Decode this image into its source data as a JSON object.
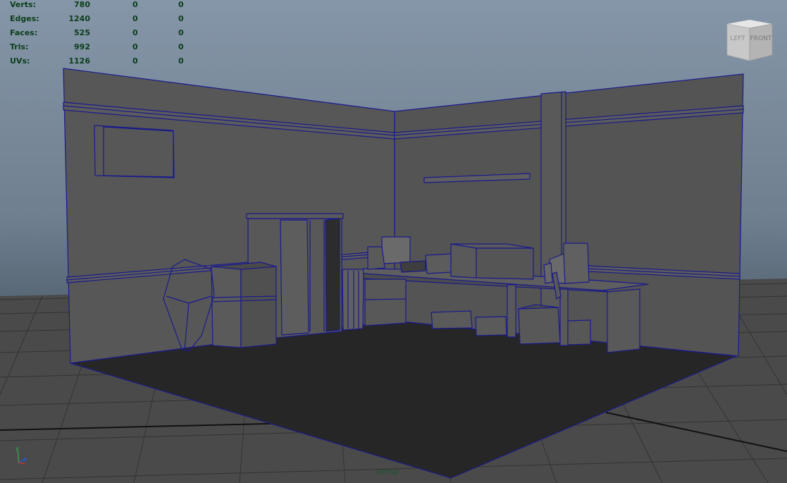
{
  "hud": {
    "rows": [
      {
        "label": "Verts:",
        "v1": "780",
        "v2": "0",
        "v3": "0"
      },
      {
        "label": "Edges:",
        "v1": "1240",
        "v2": "0",
        "v3": "0"
      },
      {
        "label": "Faces:",
        "v1": "525",
        "v2": "0",
        "v3": "0"
      },
      {
        "label": "Tris:",
        "v1": "992",
        "v2": "0",
        "v3": "0"
      },
      {
        "label": "UVs:",
        "v1": "1126",
        "v2": "0",
        "v3": "0"
      }
    ]
  },
  "viewcube": {
    "left": "LEFT",
    "front": "FRONT"
  },
  "camera": {
    "name": "persp"
  },
  "axis": {
    "y": "y",
    "z": "z"
  },
  "colors": {
    "wire": "#1a1a8c",
    "wall": "#555555",
    "floor": "#262626",
    "hud_text": "#0b3d1a"
  }
}
